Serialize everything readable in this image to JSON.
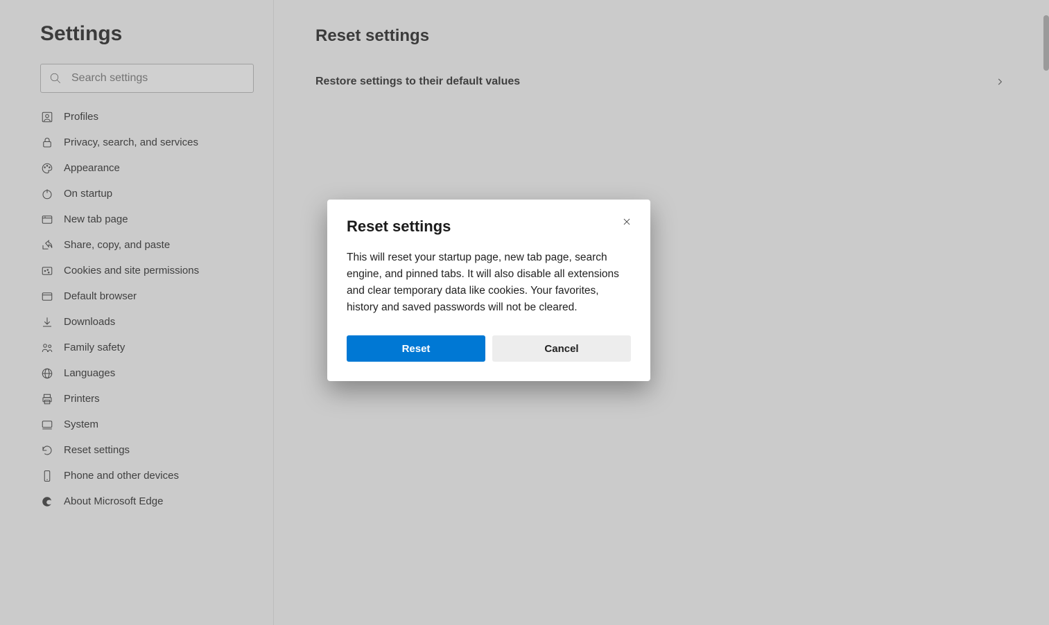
{
  "sidebar": {
    "title": "Settings",
    "search_placeholder": "Search settings",
    "items": [
      {
        "label": "Profiles",
        "icon": "profiles-icon"
      },
      {
        "label": "Privacy, search, and services",
        "icon": "privacy-icon"
      },
      {
        "label": "Appearance",
        "icon": "appearance-icon"
      },
      {
        "label": "On startup",
        "icon": "startup-icon"
      },
      {
        "label": "New tab page",
        "icon": "new-tab-icon"
      },
      {
        "label": "Share, copy, and paste",
        "icon": "share-icon"
      },
      {
        "label": "Cookies and site permissions",
        "icon": "cookies-icon"
      },
      {
        "label": "Default browser",
        "icon": "default-browser-icon"
      },
      {
        "label": "Downloads",
        "icon": "download-icon"
      },
      {
        "label": "Family safety",
        "icon": "family-icon"
      },
      {
        "label": "Languages",
        "icon": "languages-icon"
      },
      {
        "label": "Printers",
        "icon": "printer-icon"
      },
      {
        "label": "System",
        "icon": "system-icon"
      },
      {
        "label": "Reset settings",
        "icon": "reset-icon"
      },
      {
        "label": "Phone and other devices",
        "icon": "phone-icon"
      },
      {
        "label": "About Microsoft Edge",
        "icon": "edge-icon"
      }
    ]
  },
  "content": {
    "title": "Reset settings",
    "restore_label": "Restore settings to their default values"
  },
  "dialog": {
    "title": "Reset settings",
    "body": "This will reset your startup page, new tab page, search engine, and pinned tabs. It will also disable all extensions and clear temporary data like cookies. Your favorites, history and saved passwords will not be cleared.",
    "reset_label": "Reset",
    "cancel_label": "Cancel"
  }
}
